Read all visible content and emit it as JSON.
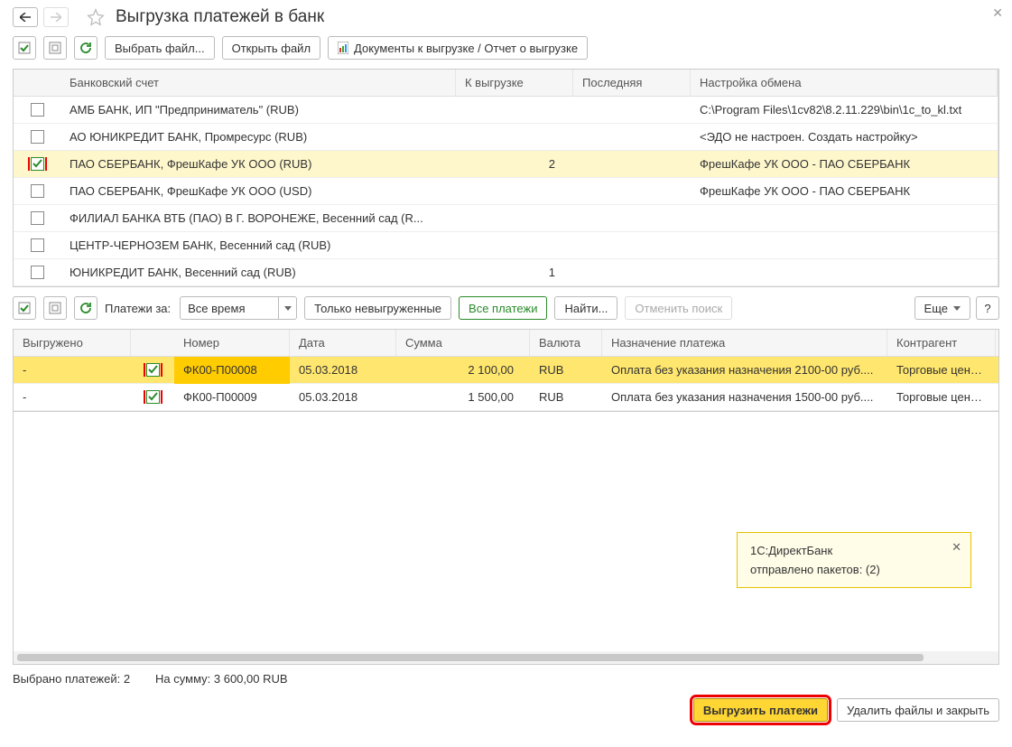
{
  "header": {
    "title": "Выгрузка платежей в банк"
  },
  "toolbar1": {
    "choose_file": "Выбрать файл...",
    "open_file": "Открыть файл",
    "docs_report": "Документы к выгрузке / Отчет о выгрузке"
  },
  "accounts": {
    "headers": {
      "account": "Банковский счет",
      "toexport": "К выгрузке",
      "last": "Последняя",
      "exchange": "Настройка обмена"
    },
    "rows": [
      {
        "checked": false,
        "hl": false,
        "account": "АМБ БАНК, ИП \"Предприниматель\" (RUB)",
        "toexport": "",
        "last": "",
        "exchange": "C:\\Program Files\\1cv82\\8.2.11.229\\bin\\1c_to_kl.txt"
      },
      {
        "checked": false,
        "hl": false,
        "account": "АО ЮНИКРЕДИТ БАНК, Промресурс (RUB)",
        "toexport": "",
        "last": "",
        "exchange": "<ЭДО не настроен. Создать настройку>"
      },
      {
        "checked": true,
        "hl": true,
        "account": "ПАО СБЕРБАНК, ФрешКафе УК ООО (RUB)",
        "toexport": "2",
        "last": "",
        "exchange": "ФрешКафе УК ООО - ПАО СБЕРБАНК"
      },
      {
        "checked": false,
        "hl": false,
        "account": "ПАО СБЕРБАНК, ФрешКафе УК ООО (USD)",
        "toexport": "",
        "last": "",
        "exchange": "ФрешКафе УК ООО - ПАО СБЕРБАНК"
      },
      {
        "checked": false,
        "hl": false,
        "account": "ФИЛИАЛ БАНКА ВТБ (ПАО) В Г. ВОРОНЕЖЕ, Весенний сад (R...",
        "toexport": "",
        "last": "",
        "exchange": ""
      },
      {
        "checked": false,
        "hl": false,
        "account": "ЦЕНТР-ЧЕРНОЗЕМ БАНК, Весенний сад (RUB)",
        "toexport": "",
        "last": "",
        "exchange": ""
      },
      {
        "checked": false,
        "hl": false,
        "account": "ЮНИКРЕДИТ БАНК, Весенний сад (RUB)",
        "toexport": "1",
        "last": "",
        "exchange": ""
      }
    ]
  },
  "midtoolbar": {
    "label": "Платежи за:",
    "period": "Все время",
    "only_not_exported": "Только невыгруженные",
    "all_payments": "Все платежи",
    "find": "Найти...",
    "cancel_search": "Отменить поиск",
    "more": "Еще",
    "help": "?"
  },
  "payments": {
    "headers": {
      "exported": "Выгружено",
      "number": "Номер",
      "date": "Дата",
      "amount": "Сумма",
      "currency": "Валюта",
      "purpose": "Назначение платежа",
      "counterparty": "Контрагент"
    },
    "rows": [
      {
        "selected": true,
        "exported": "-",
        "checked": true,
        "number": "ФК00-П00008",
        "date": "05.03.2018",
        "amount": "2 100,00",
        "currency": "RUB",
        "purpose": "Оплата без указания назначения 2100-00 руб....",
        "counterparty": "Торговые центры -"
      },
      {
        "selected": false,
        "exported": "-",
        "checked": true,
        "number": "ФК00-П00009",
        "date": "05.03.2018",
        "amount": "1 500,00",
        "currency": "RUB",
        "purpose": "Оплата без указания назначения 1500-00 руб....",
        "counterparty": "Торговые центры -"
      }
    ]
  },
  "toast": {
    "title": "1С:ДиректБанк",
    "body": "отправлено пакетов: (2)"
  },
  "status": {
    "selected": "Выбрано платежей: 2",
    "sum": "На сумму: 3 600,00 RUB"
  },
  "footer": {
    "export": "Выгрузить платежи",
    "delete_close": "Удалить файлы и закрыть"
  }
}
